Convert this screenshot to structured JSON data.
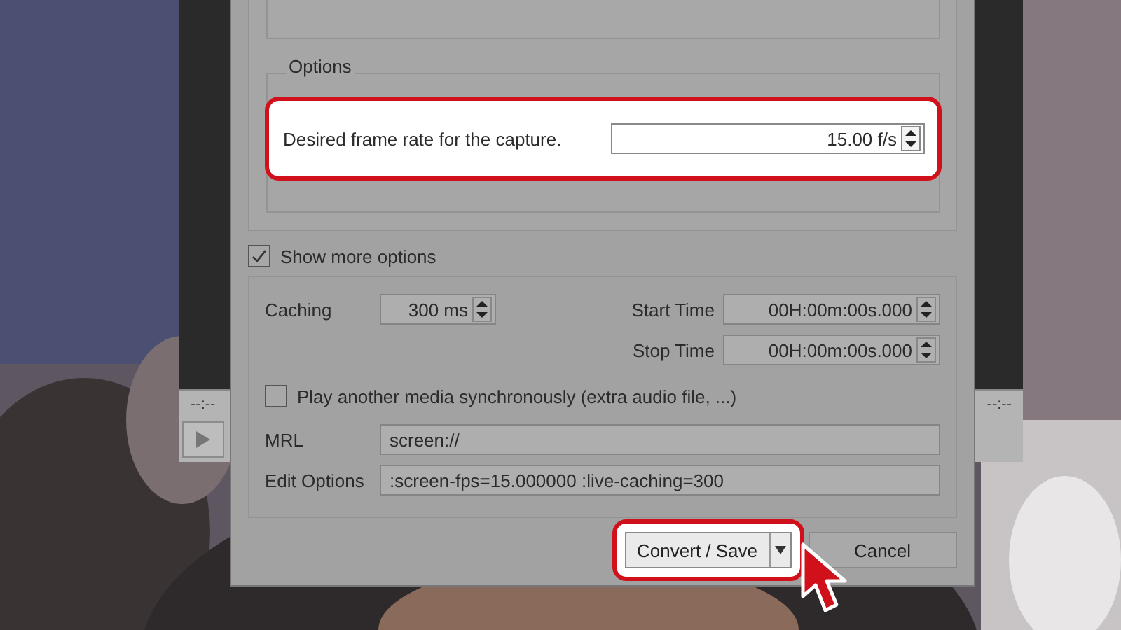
{
  "player": {
    "time_elapsed": "--:--",
    "time_total": "--:--"
  },
  "dialog": {
    "options_group": {
      "title": "Options",
      "frame_rate": {
        "label": "Desired frame rate for the capture.",
        "value": "15.00 f/s",
        "highlighted": true
      }
    },
    "show_more_options": {
      "label": "Show more options",
      "checked": true
    },
    "caching": {
      "label": "Caching",
      "value": "300 ms"
    },
    "start_time": {
      "label": "Start Time",
      "value": "00H:00m:00s.000"
    },
    "stop_time": {
      "label": "Stop Time",
      "value": "00H:00m:00s.000"
    },
    "play_another": {
      "label": "Play another media synchronously (extra audio file, ...)",
      "checked": false
    },
    "mrl": {
      "label": "MRL",
      "value": "screen://"
    },
    "edit_options": {
      "label": "Edit Options",
      "value": ":screen-fps=15.000000 :live-caching=300"
    },
    "buttons": [
      {
        "label": "Convert / Save",
        "kind": "split",
        "highlighted": true
      },
      {
        "label": "Cancel",
        "kind": "plain",
        "highlighted": false
      }
    ]
  }
}
